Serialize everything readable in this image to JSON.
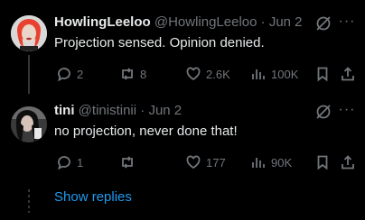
{
  "tweets": [
    {
      "author_name": "HowlingLeeloo",
      "handle": "@HowlingLeeloo",
      "separator": "·",
      "date": "Jun 2",
      "text": "Projection sensed. Opinion denied.",
      "reply_count": "2",
      "retweet_count": "8",
      "like_count": "2.6K",
      "view_count": "100K",
      "avatar_colors": {
        "hair": "#e8412f",
        "skin": "#e9d6c8",
        "bg": "#d8d8d8"
      }
    },
    {
      "author_name": "tini",
      "handle": "@tinistinii",
      "separator": "·",
      "date": "Jun 2",
      "text": "no projection, never done that!",
      "reply_count": "1",
      "retweet_count": "",
      "like_count": "177",
      "view_count": "90K",
      "avatar_colors": {
        "hair": "#0f0f0f",
        "skin": "#d6c2b8",
        "bg": "#3a3a3a"
      }
    }
  ],
  "show_replies_label": "Show replies",
  "more_label": "···",
  "colors": {
    "background": "#000000",
    "text": "#e7e9ea",
    "muted": "#71767b",
    "link": "#1d9bf0"
  },
  "icons": [
    "grok-icon",
    "more-icon",
    "reply-icon",
    "retweet-icon",
    "like-icon",
    "views-icon",
    "bookmark-icon",
    "share-icon"
  ]
}
